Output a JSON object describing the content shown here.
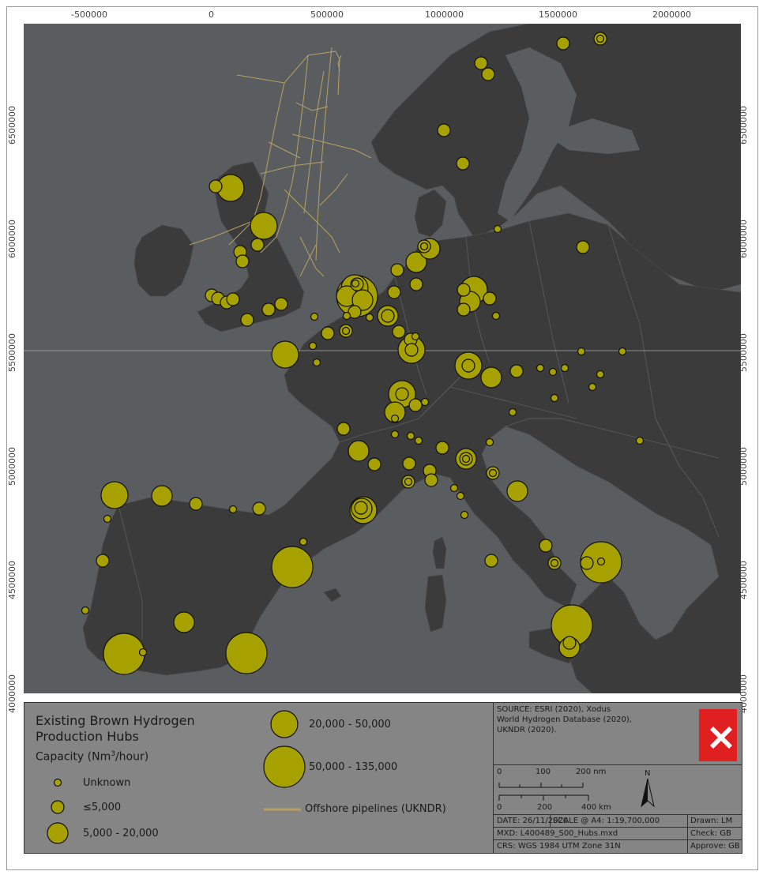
{
  "axes": {
    "top_ticks": [
      "-500000",
      "0",
      "500000",
      "1000000",
      "1500000",
      "2000000"
    ],
    "left_ticks": [
      "6500000",
      "6000000",
      "5500000",
      "5000000",
      "4500000",
      "4000000"
    ],
    "right_ticks": [
      "6500000",
      "6000000",
      "5500000",
      "5000000",
      "4500000",
      "4000000"
    ]
  },
  "legend": {
    "title_line1": "Existing Brown Hydrogen",
    "title_line2": "Production Hubs",
    "capacity_label": "Capacity (Nm",
    "capacity_sup": "3",
    "capacity_suffix": "/hour)",
    "classes": {
      "unknown": "Unknown",
      "c1": "≤5,000",
      "c2": "5,000 - 20,000",
      "c3": "20,000 - 50,000",
      "c4": "50,000 - 135,000"
    },
    "pipeline_label": "Offshore pipelines (UKNDR)"
  },
  "info": {
    "source_line1": "SOURCE: ESRI (2020), Xodus",
    "source_line2": "World Hydrogen Database (2020),",
    "source_line3": "UKNDR (2020).",
    "scale_nm": [
      "0",
      "100",
      "200 nm"
    ],
    "scale_km": [
      "0",
      "200",
      "400 km"
    ],
    "north": "N",
    "date": "DATE: 26/11/2020",
    "scale": "SCALE @ A4:  1:19,700,000",
    "drawn": "Drawn: LM",
    "mxd": "MXD: L400489_S00_Hubs.mxd",
    "check": "Check: GB",
    "crs": "CRS: WGS 1984 UTM Zone 31N",
    "approve": "Approve: GB"
  },
  "colors": {
    "hub_fill": "#a7a100",
    "sea": "#5a5d60",
    "land": "#3b3b3b",
    "pipeline": "#b8a060",
    "logo_red": "#e02020"
  }
}
